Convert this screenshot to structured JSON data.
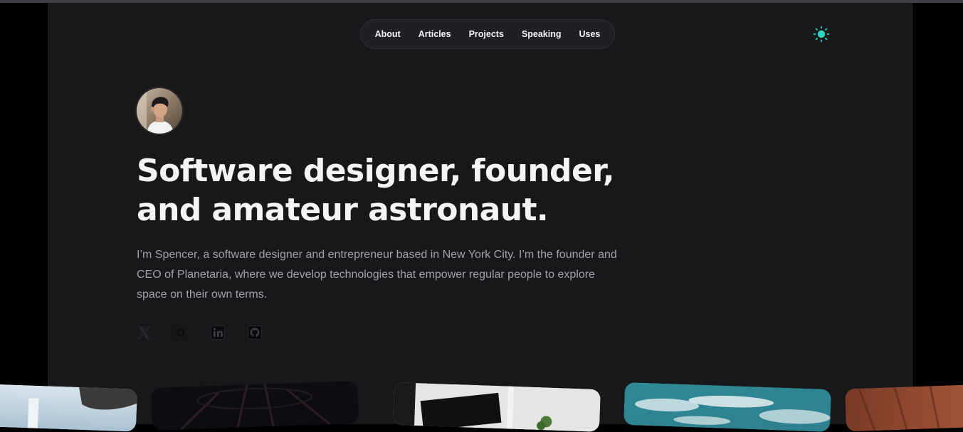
{
  "nav": {
    "items": [
      "About",
      "Articles",
      "Projects",
      "Speaking",
      "Uses"
    ]
  },
  "theme_toggle": {
    "icon": "sun-icon",
    "accent": "#2dd4bf"
  },
  "hero": {
    "headline_line1": "Software designer, founder,",
    "headline_line2": "and amateur astronaut.",
    "intro": "I’m Spencer, a software designer and entrepreneur based in New York City. I’m the founder and CEO of Planetaria, where we develop technologies that empower regular people to explore space on their own terms."
  },
  "social": [
    "x-icon",
    "instagram-icon",
    "linkedin-icon",
    "github-icon"
  ],
  "colors": {
    "page_bg": "#000000",
    "panel_bg": "#18181b",
    "heading": "#f4f4f5",
    "body_text": "#a1a1aa",
    "icon": "#71717a"
  }
}
